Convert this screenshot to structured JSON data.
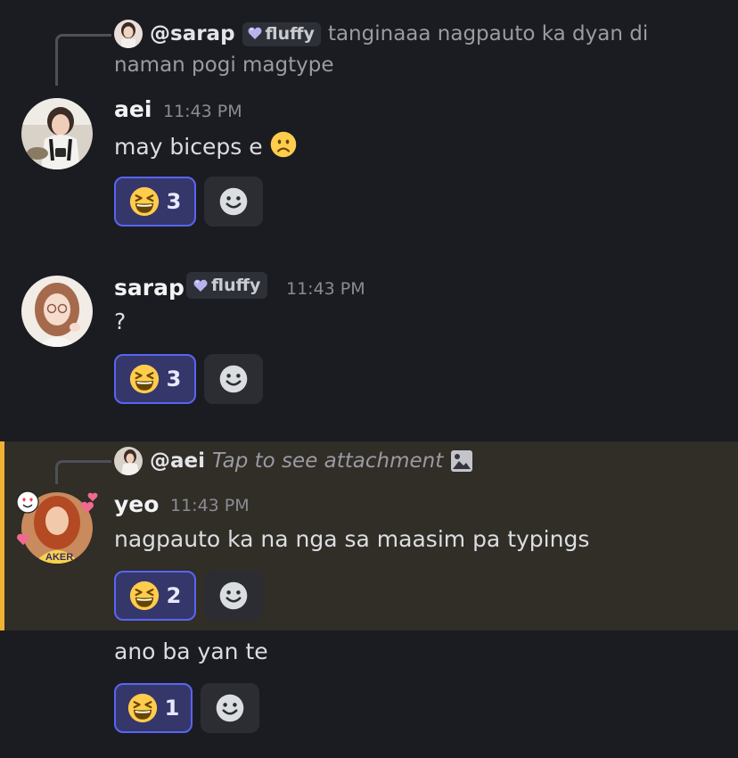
{
  "messages": [
    {
      "reply": {
        "name": "@sarap",
        "tag": "fluffy",
        "text_line1": "tanginaaa nagpauto ka dyan di",
        "text_line2": "naman pogi magtype"
      },
      "author": "aei",
      "time": "11:43 PM",
      "text": "may biceps e",
      "text_emoji": "☹",
      "reaction": {
        "emoji": "laughing",
        "count": "3"
      }
    },
    {
      "author": "sarap",
      "tag": "fluffy",
      "time": "11:43 PM",
      "text": "?",
      "reaction": {
        "emoji": "laughing",
        "count": "3"
      }
    },
    {
      "reply": {
        "name": "@aei",
        "text": "Tap to see attachment"
      },
      "author": "yeo",
      "time": "11:43 PM",
      "text": "nagpauto ka na nga sa maasim pa typings",
      "reaction": {
        "emoji": "laughing",
        "count": "2"
      }
    },
    {
      "text": "ano ba yan te",
      "reaction": {
        "emoji": "laughing",
        "count": "1"
      }
    }
  ],
  "colors": {
    "background": "#1b1c21",
    "highlight": "#312d27",
    "highlight_bar": "#f0b232",
    "reaction_bg": "#35376a",
    "reaction_border": "#5865f2"
  }
}
